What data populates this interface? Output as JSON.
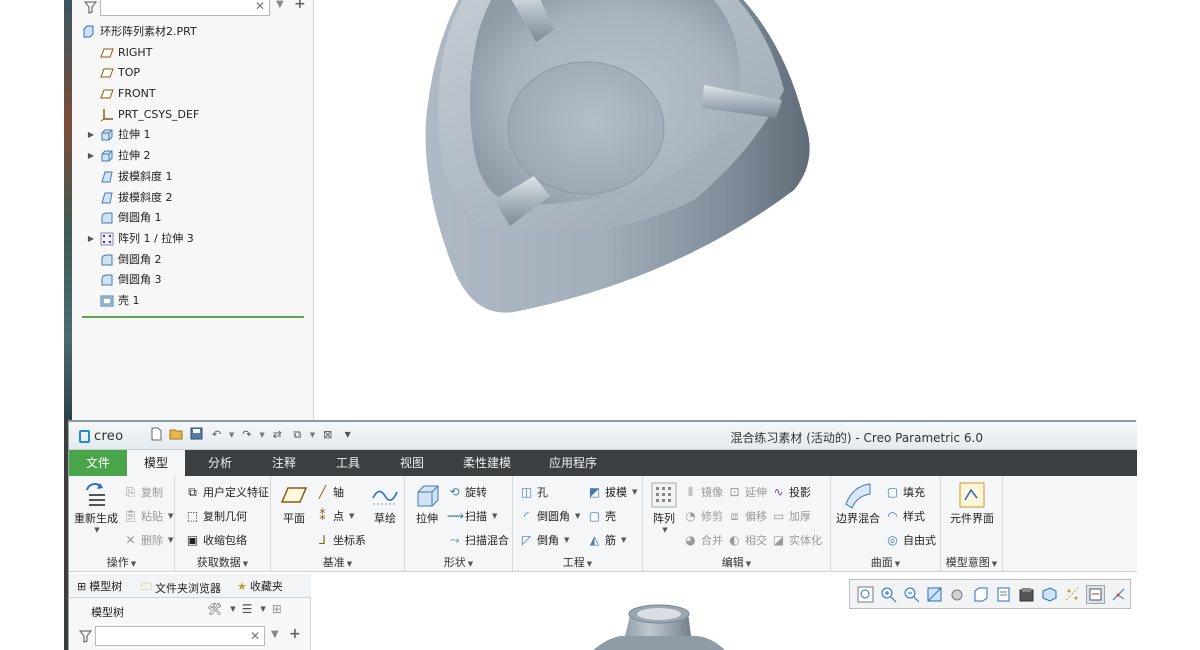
{
  "upper": {
    "tree_items": [
      {
        "label": "环形阵列素材2.PRT",
        "icon": "part-icon",
        "expandable": false,
        "level": 0
      },
      {
        "label": "RIGHT",
        "icon": "datum-plane-icon",
        "expandable": false,
        "level": 1
      },
      {
        "label": "TOP",
        "icon": "datum-plane-icon",
        "expandable": false,
        "level": 1
      },
      {
        "label": "FRONT",
        "icon": "datum-plane-icon",
        "expandable": false,
        "level": 1
      },
      {
        "label": "PRT_CSYS_DEF",
        "icon": "csys-icon",
        "expandable": false,
        "level": 1
      },
      {
        "label": "拉伸 1",
        "icon": "extrude-icon",
        "expandable": true,
        "level": 1
      },
      {
        "label": "拉伸 2",
        "icon": "extrude-icon",
        "expandable": true,
        "level": 1
      },
      {
        "label": "拔模斜度 1",
        "icon": "draft-icon",
        "expandable": false,
        "level": 1
      },
      {
        "label": "拔模斜度 2",
        "icon": "draft-icon",
        "expandable": false,
        "level": 1
      },
      {
        "label": "倒圆角 1",
        "icon": "round-icon",
        "expandable": false,
        "level": 1
      },
      {
        "label": "阵列 1 / 拉伸 3",
        "icon": "pattern-icon",
        "expandable": true,
        "level": 1
      },
      {
        "label": "倒圆角 2",
        "icon": "round-icon",
        "expandable": false,
        "level": 1
      },
      {
        "label": "倒圆角 3",
        "icon": "round-icon",
        "expandable": false,
        "level": 1
      },
      {
        "label": "壳 1",
        "icon": "shell-icon",
        "expandable": false,
        "level": 1
      }
    ]
  },
  "window": {
    "logo": "creo",
    "title": "混合练习素材 (活动的) - Creo Parametric 6.0"
  },
  "tabs": [
    {
      "label": "文件",
      "key": "file"
    },
    {
      "label": "模型",
      "key": "model",
      "active": true
    },
    {
      "label": "分析",
      "key": "analysis"
    },
    {
      "label": "注释",
      "key": "annotate"
    },
    {
      "label": "工具",
      "key": "tools"
    },
    {
      "label": "视图",
      "key": "view"
    },
    {
      "label": "柔性建模",
      "key": "flex"
    },
    {
      "label": "应用程序",
      "key": "apps"
    }
  ],
  "ribbon": {
    "operations": {
      "label": "操作",
      "regen": "重新生成",
      "copy": "复制",
      "paste": "粘贴",
      "delete": "删除"
    },
    "get_data": {
      "label": "获取数据",
      "udf": "用户定义特征",
      "copy_geom": "复制几何",
      "shrinkwrap": "收缩包络"
    },
    "datum": {
      "label": "基准",
      "plane": "平面",
      "axis": "轴",
      "point": "点",
      "csys": "坐标系",
      "sketch": "草绘"
    },
    "shapes": {
      "label": "形状",
      "extrude": "拉伸",
      "revolve": "旋转",
      "sweep": "扫描",
      "swept_blend": "扫描混合"
    },
    "engineering": {
      "label": "工程",
      "hole": "孔",
      "round": "倒圆角",
      "chamfer": "倒角",
      "draft": "拔模",
      "shell": "壳",
      "rib": "筋"
    },
    "editing": {
      "label": "编辑",
      "pattern": "阵列",
      "mirror": "镜像",
      "trim": "修剪",
      "merge": "合并",
      "extend": "延伸",
      "offset": "偏移",
      "intersect": "相交",
      "project": "投影",
      "thicken": "加厚",
      "solidify": "实体化"
    },
    "surfaces": {
      "label": "曲面",
      "boundary_blend": "边界混合",
      "fill": "填充",
      "style": "样式",
      "freestyle": "自由式"
    },
    "model_intent": {
      "label": "模型意图",
      "component_interface": "元件界面"
    }
  },
  "panel_tabs": [
    {
      "label": "模型树",
      "icon": "model-tree-icon"
    },
    {
      "label": "文件夹浏览器",
      "icon": "folder-icon"
    },
    {
      "label": "收藏夹",
      "icon": "favorites-icon"
    }
  ],
  "lower_panel": {
    "model_tree_label": "模型树"
  },
  "colors": {
    "file_tab": "#4aa54a",
    "tab_bar": "#3c3f41",
    "ribbon_bg": "#f4f6f7",
    "model_gray": "#9aa7b3"
  }
}
